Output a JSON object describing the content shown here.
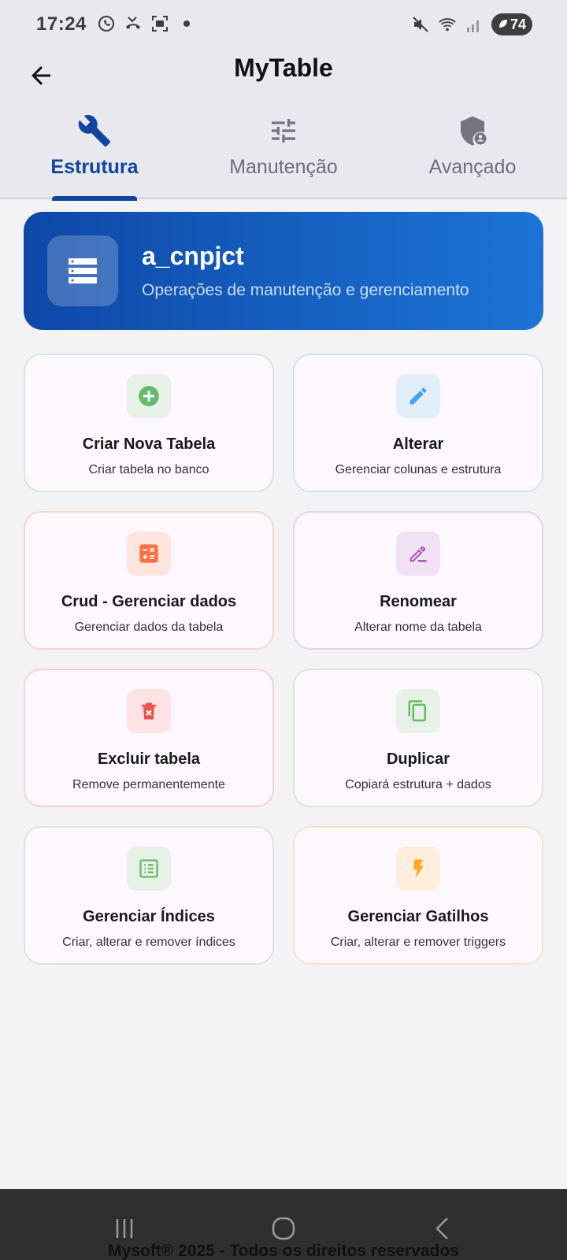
{
  "status": {
    "time": "17:24",
    "battery": "74",
    "left_icons": [
      "whatsapp-icon",
      "missed-call-icon",
      "screenshot-icon",
      "dot-icon"
    ],
    "right_icons": [
      "mute-icon",
      "wifi-icon",
      "signal-icon"
    ]
  },
  "appbar": {
    "title": "MyTable"
  },
  "tabs": [
    {
      "label": "Estrutura",
      "icon": "wrench-icon",
      "active": true
    },
    {
      "label": "Manutenção",
      "icon": "tune-icon",
      "active": false
    },
    {
      "label": "Avançado",
      "icon": "admin-shield-icon",
      "active": false
    }
  ],
  "header": {
    "title": "a_cnpjct",
    "subtitle": "Operações de manutenção e gerenciamento",
    "icon": "table-rows-icon",
    "gradient": [
      "#0e48a7",
      "#1c74d6"
    ]
  },
  "cards": [
    {
      "title": "Criar Nova Tabela",
      "subtitle": "Criar tabela no banco",
      "icon": "add-circle-icon",
      "color": "#66bb6a"
    },
    {
      "title": "Alterar",
      "subtitle": "Gerenciar colunas e estrutura",
      "icon": "edit-icon",
      "color": "#42a5f5"
    },
    {
      "title": "Crud - Gerenciar dados",
      "subtitle": "Gerenciar dados da tabela",
      "icon": "calculate-icon",
      "color": "#ff7043"
    },
    {
      "title": "Renomear",
      "subtitle": "Alterar nome da tabela",
      "icon": "rename-icon",
      "color": "#ab47bc"
    },
    {
      "title": "Excluir tabela",
      "subtitle": "Remove permanentemente",
      "icon": "delete-icon",
      "color": "#ef5350"
    },
    {
      "title": "Duplicar",
      "subtitle": "Copiará estrutura + dados",
      "icon": "copy-icon",
      "color": "#66bb6a"
    },
    {
      "title": "Gerenciar Índices",
      "subtitle": "Criar, alterar e remover índices",
      "icon": "list-icon",
      "color": "#66bb6a"
    },
    {
      "title": "Gerenciar Gatilhos",
      "subtitle": "Criar, alterar e remover triggers",
      "icon": "bolt-icon",
      "color": "#ffa726"
    }
  ],
  "footer": {
    "text": "Mysoft® 2025 - Todos os direitos reservados"
  },
  "colors": {
    "primary": "#1145a0",
    "background": "#f3f3f5"
  }
}
